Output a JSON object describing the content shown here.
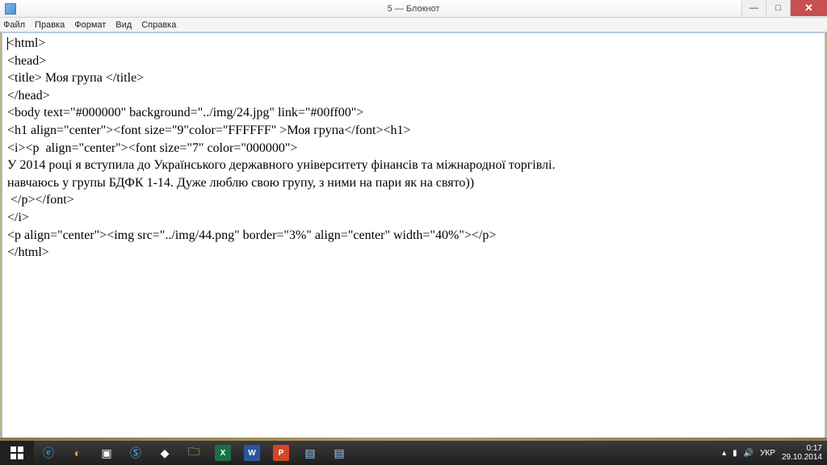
{
  "window": {
    "title": "5 — Блокнот"
  },
  "menu": {
    "file": "Файл",
    "edit": "Правка",
    "format": "Формат",
    "view": "Вид",
    "help": "Справка"
  },
  "editor": {
    "lines": [
      "<html>",
      "<head>",
      "<title> Моя група </title>",
      "</head>",
      "<body text=\"#000000\" background=\"../img/24.jpg\" link=\"#00ff00\">",
      "<h1 align=\"center\"><font size=\"9\"color=\"FFFFFF\" >Моя група</font><h1>",
      "<i><p  align=\"center\"><font size=\"7\" color=\"000000\">",
      "У 2014 році я вступила до Українського державного університету фінансів та міжнародної торгівлі.",
      "навчаюсь у групы БДФК 1-14. Дуже люблю свою групу, з ними на пари як на свято))",
      " </p></font>",
      "</i>",
      "<p align=\"center\"><img src=\"../img/44.png\" border=\"3%\" align=\"center\" width=\"40%\"></p>",
      "</html>"
    ]
  },
  "tray": {
    "lang": "УКР",
    "time": "0:17",
    "date": "29.10.2014"
  }
}
